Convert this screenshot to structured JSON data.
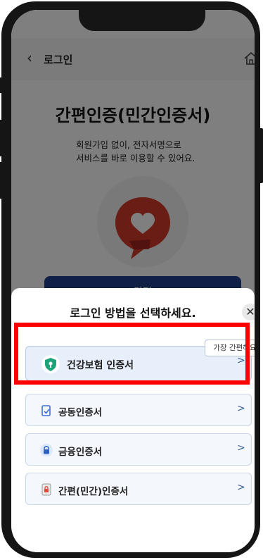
{
  "header": {
    "title": "로그인"
  },
  "hero": {
    "title": "간편인증(민간인증서)",
    "desc_line1": "회원가입 없이, 전자서명으로",
    "desc_line2": "서비스를 바로 이용할 수 있어요."
  },
  "primary_button_label": "간편",
  "sheet": {
    "title": "로그인 방법을 선택하세요.",
    "tooltip": "가장 간편해요!",
    "options": [
      {
        "label": "건강보험 인증서",
        "icon": "shield-icon"
      },
      {
        "label": "공동인증서",
        "icon": "document-icon"
      },
      {
        "label": "금융인증서",
        "icon": "lock-icon"
      },
      {
        "label": "간편(민간)인증서",
        "icon": "phone-lock-icon"
      }
    ]
  },
  "colors": {
    "accent": "#1f3f8a",
    "highlight": "#ff0000",
    "shield": "#1ea47a",
    "logo": "#d43a2a"
  }
}
